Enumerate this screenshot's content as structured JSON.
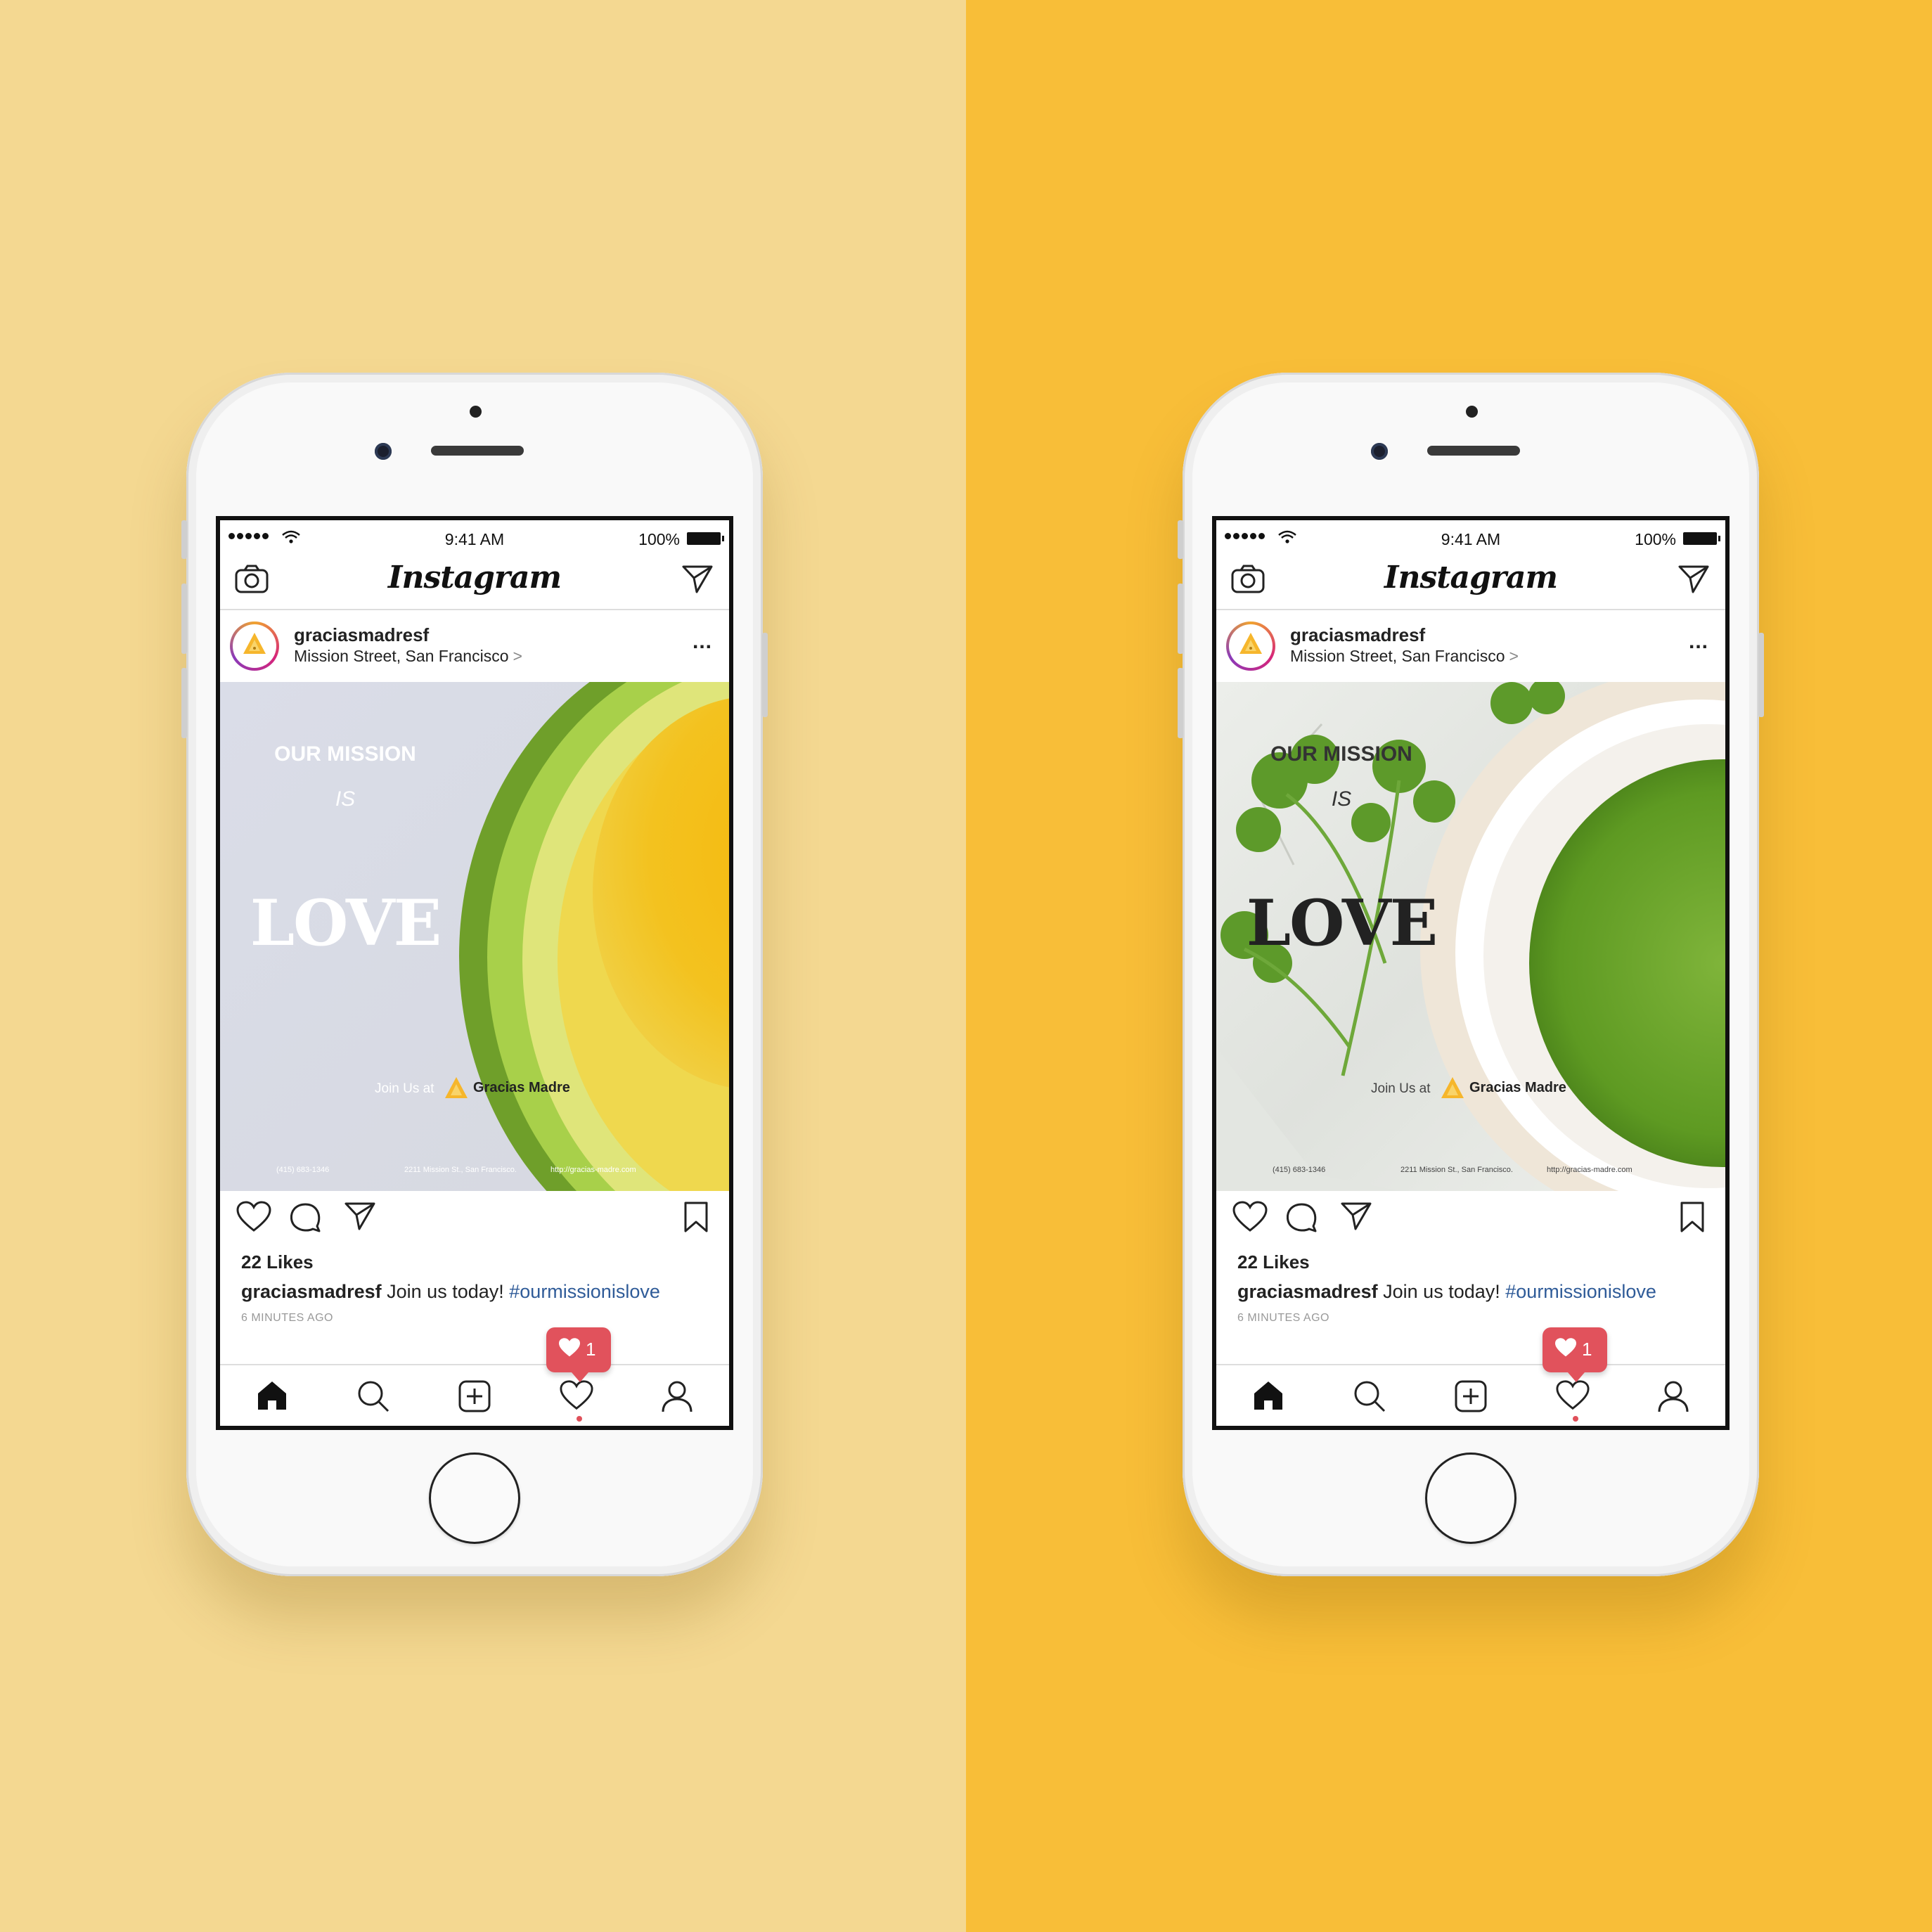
{
  "colors": {
    "bg_left": "#f4d891",
    "bg_right": "#f8be38",
    "notification": "#e1525c",
    "hashtag": "#2f5b98"
  },
  "phones": [
    {
      "status": {
        "time": "9:41 AM",
        "battery": "100%"
      },
      "app": {
        "logo": "Instagram"
      },
      "post": {
        "username": "graciasmadresf",
        "location": "Mission Street, San Francisco",
        "location_arrow": ">",
        "image": {
          "line1": "OUR MISSION",
          "line2": "IS",
          "line3": "LOVE",
          "join": "Join Us at",
          "brand": "Gracias Madre",
          "phone": "(415) 683-1346",
          "address": "2211 Mission St., San Francisco.",
          "url": "http://gracias-madre.com"
        },
        "likes": "22 Likes",
        "caption_user": "graciasmadresf",
        "caption_text": "Join us today!",
        "hashtag": "#ourmissionislove",
        "time_ago": "6 MINUTES AGO"
      },
      "notification": {
        "count": "1"
      }
    },
    {
      "status": {
        "time": "9:41 AM",
        "battery": "100%"
      },
      "app": {
        "logo": "Instagram"
      },
      "post": {
        "username": "graciasmadresf",
        "location": "Mission Street, San Francisco",
        "location_arrow": ">",
        "image": {
          "line1": "OUR MISSION",
          "line2": "IS",
          "line3": "LOVE",
          "join": "Join Us at",
          "brand": "Gracias Madre",
          "phone": "(415) 683-1346",
          "address": "2211 Mission St., San Francisco.",
          "url": "http://gracias-madre.com"
        },
        "likes": "22 Likes",
        "caption_user": "graciasmadresf",
        "caption_text": "Join us today!",
        "hashtag": "#ourmissionislove",
        "time_ago": "6 MINUTES AGO"
      },
      "notification": {
        "count": "1"
      }
    }
  ]
}
